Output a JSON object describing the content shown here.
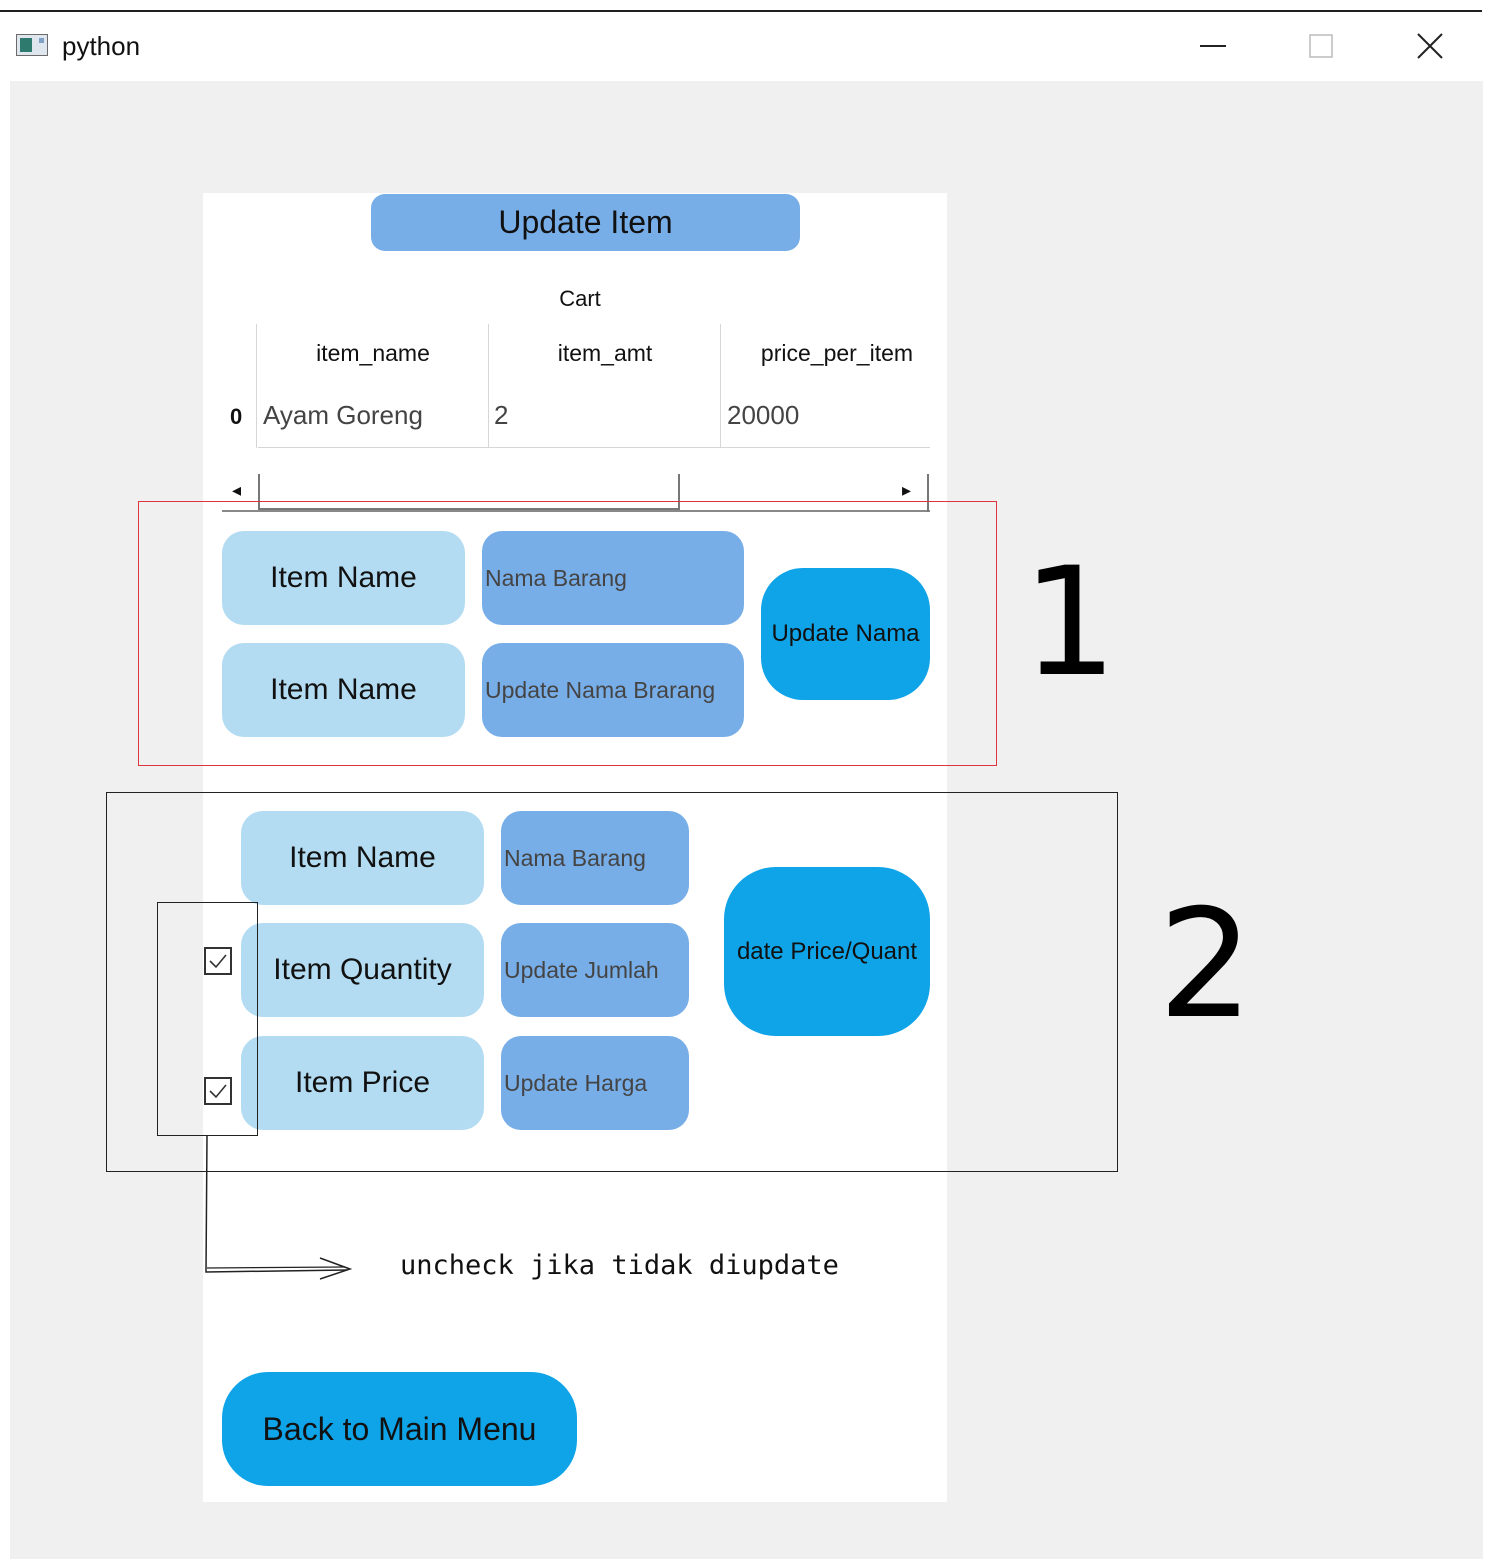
{
  "window": {
    "title": "python",
    "controls": {
      "minimize": "—",
      "close": "✕"
    }
  },
  "header_button": "Update Item",
  "cart": {
    "label": "Cart",
    "columns": [
      "item_name",
      "item_amt",
      "price_per_item"
    ],
    "rows": [
      {
        "index": "0",
        "cells": [
          "Ayam Goreng",
          "2",
          "20000"
        ]
      }
    ],
    "scroll_left": "◂",
    "scroll_right": "▸"
  },
  "section1": {
    "label1": "Item Name",
    "input1_placeholder": "Nama Barang",
    "label2": "Item Name",
    "input2_placeholder": "Update Nama Brarang",
    "action": "Update Nama"
  },
  "section2": {
    "label1": "Item Name",
    "input1_placeholder": "Nama Barang",
    "label2": "Item Quantity",
    "input2_placeholder": "Update Jumlah",
    "label3": "Item Price",
    "input3_placeholder": "Update Harga",
    "action": "date Price/Quant"
  },
  "checkboxes": {
    "quantity_checked": true,
    "price_checked": true
  },
  "back_button": "Back to Main Menu",
  "annotations": {
    "marker1": "1",
    "marker2": "2",
    "note": "uncheck jika tidak diupdate"
  }
}
